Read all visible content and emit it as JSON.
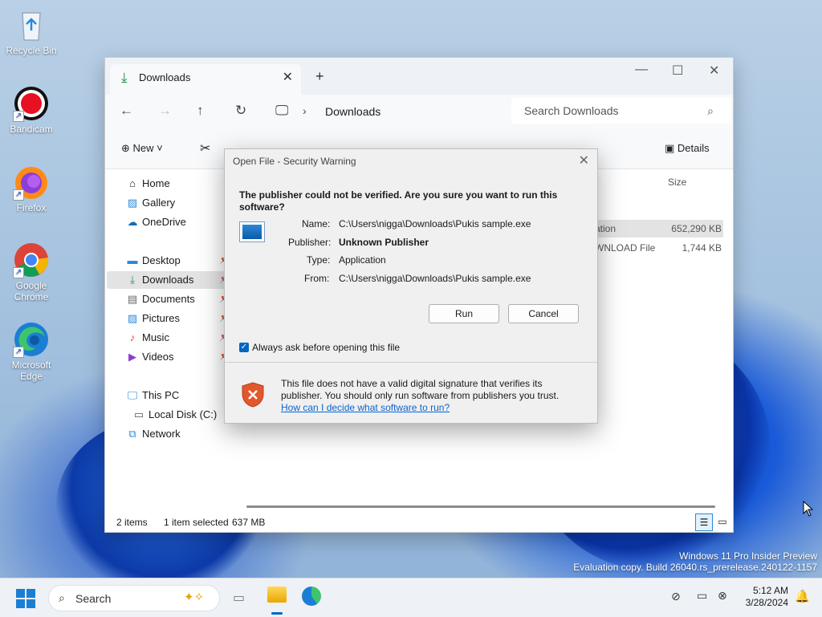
{
  "desktop": {
    "icons": [
      {
        "label": "Recycle Bin"
      },
      {
        "label": "Bandicam"
      },
      {
        "label": "Firefox"
      },
      {
        "label": "Google Chrome"
      },
      {
        "label": "Microsoft Edge"
      }
    ],
    "watermark_line1": "Windows 11 Pro Insider Preview",
    "watermark_line2": "Evaluation copy. Build 26040.rs_prerelease.240122-1157"
  },
  "explorer": {
    "tab_title": "Downloads",
    "breadcrumb": "Downloads",
    "search_placeholder": "Search Downloads",
    "cmd_new": "New",
    "cmd_details": "Details",
    "column_size": "Size",
    "sidebar": [
      {
        "label": "Home"
      },
      {
        "label": "Gallery"
      },
      {
        "label": "OneDrive"
      },
      {
        "label": "Desktop"
      },
      {
        "label": "Downloads"
      },
      {
        "label": "Documents"
      },
      {
        "label": "Pictures"
      },
      {
        "label": "Music"
      },
      {
        "label": "Videos"
      },
      {
        "label": "This PC"
      },
      {
        "label": "Local Disk (C:)"
      },
      {
        "label": "Network"
      }
    ],
    "files": [
      {
        "type_fragment": "ation",
        "size": "652,290 KB"
      },
      {
        "type_fragment": "WNLOAD File",
        "size": "1,744 KB"
      }
    ],
    "status_items": "2 items",
    "status_selected": "1 item selected",
    "status_size": "637 MB"
  },
  "dialog": {
    "title": "Open File - Security Warning",
    "question": "The publisher could not be verified.  Are you sure you want to run this software?",
    "name_label": "Name:",
    "name_value": "C:\\Users\\nigga\\Downloads\\Pukis sample.exe",
    "publisher_label": "Publisher:",
    "publisher_value": "Unknown Publisher",
    "type_label": "Type:",
    "type_value": "Application",
    "from_label": "From:",
    "from_value": "C:\\Users\\nigga\\Downloads\\Pukis sample.exe",
    "run_label": "Run",
    "cancel_label": "Cancel",
    "checkbox_label": "Always ask before opening this file",
    "checkbox_checked": true,
    "footer_text": "This file does not have a valid digital signature that verifies its publisher.  You should only run software from publishers you trust.",
    "footer_link": "How can I decide what software to run?"
  },
  "taskbar": {
    "search_placeholder": "Search",
    "time": "5:12 AM",
    "date": "3/28/2024"
  }
}
